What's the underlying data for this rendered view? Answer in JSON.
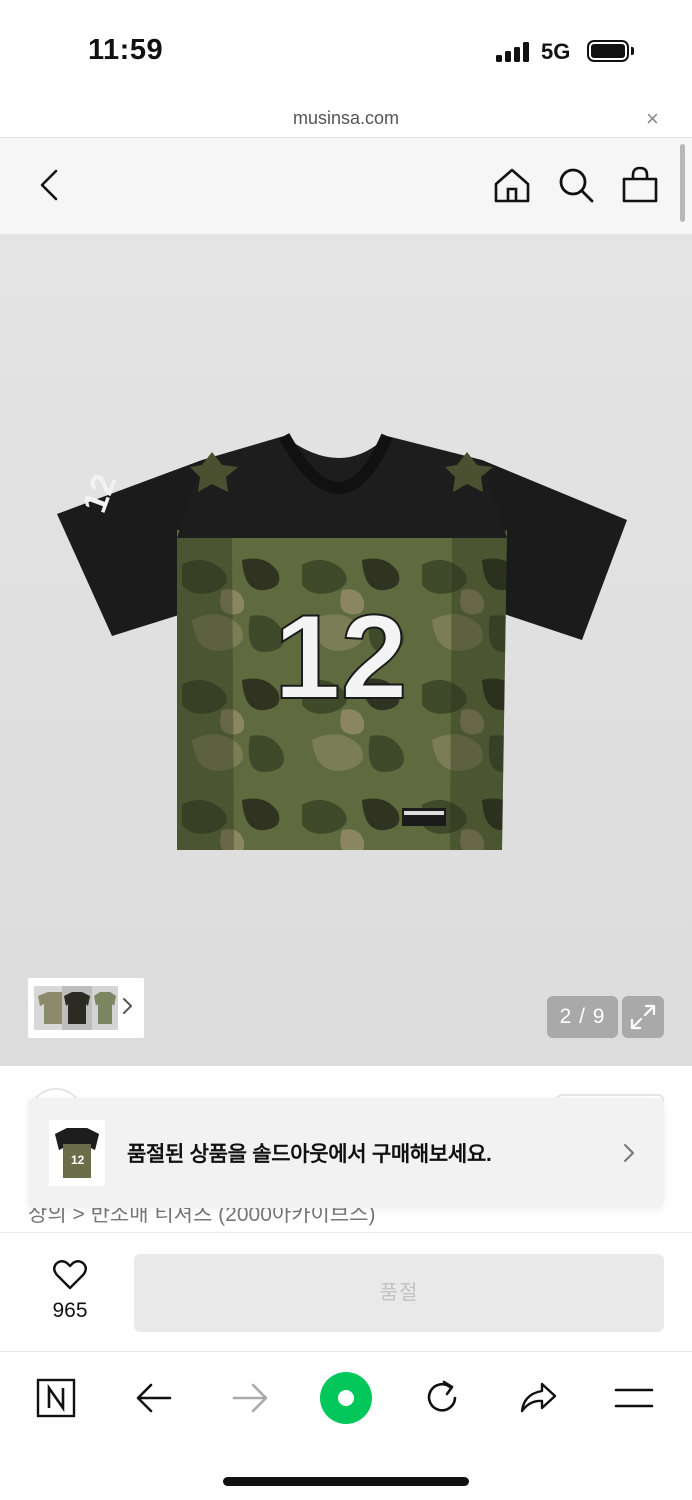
{
  "status_bar": {
    "time": "11:59",
    "network": "5G"
  },
  "url_bar": {
    "url": "musinsa.com",
    "close_glyph": "×"
  },
  "header": {
    "icons": [
      "back-chevron-icon",
      "home-icon",
      "search-icon",
      "shopping-bag-icon"
    ]
  },
  "gallery": {
    "counter": "2 / 9",
    "current_image": 2,
    "total_images": 9,
    "jersey_number": "12"
  },
  "toast": {
    "message": "품절된 상품을 솔드아웃에서 구매해보세요."
  },
  "breadcrumb": {
    "text": "상의 > 반소매 티셔츠 (2000아카이브스)"
  },
  "buy_bar": {
    "likes": "965",
    "soldout_label": "품절"
  },
  "colors": {
    "brand_green": "#03c75a",
    "soldout_bg": "#e9e9e9",
    "soldout_text": "#c2c2c2"
  },
  "browser_toolbar": {
    "icons": [
      "naver-n-icon",
      "back-arrow-icon",
      "forward-arrow-icon",
      "naver-green-dot-icon",
      "reload-icon",
      "share-icon",
      "menu-icon"
    ]
  }
}
